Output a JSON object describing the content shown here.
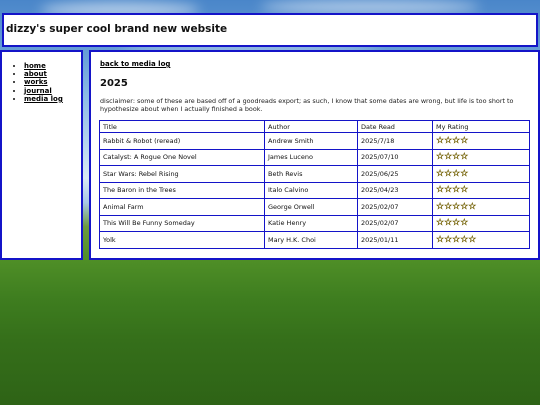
{
  "header": {
    "site_title": "dizzy's super cool brand new website"
  },
  "nav": {
    "items": [
      {
        "label": "home"
      },
      {
        "label": "about"
      },
      {
        "label": "works"
      },
      {
        "label": "journal"
      },
      {
        "label": "media log"
      }
    ]
  },
  "main": {
    "back_link": "back to media log",
    "year": "2025",
    "disclaimer": "disclaimer: some of these are based off of a goodreads export; as such, I know that some dates are wrong, but life is too short to hypothesize about when I actually finished a book.",
    "table": {
      "columns": [
        "Title",
        "Author",
        "Date Read",
        "My Rating"
      ],
      "rows": [
        {
          "title": "Rabbit & Robot (reread)",
          "author": "Andrew Smith",
          "date": "2025/7/18",
          "rating": 4,
          "stars": "☆☆☆☆"
        },
        {
          "title": "Catalyst: A Rogue One Novel",
          "author": "James Luceno",
          "date": "2025/07/10",
          "rating": 4,
          "stars": "☆☆☆☆"
        },
        {
          "title": "Star Wars: Rebel Rising",
          "author": "Beth Revis",
          "date": "2025/06/25",
          "rating": 4,
          "stars": "☆☆☆☆"
        },
        {
          "title": "The Baron in the Trees",
          "author": "Italo Calvino",
          "date": "2025/04/23",
          "rating": 4,
          "stars": "☆☆☆☆"
        },
        {
          "title": "Animal Farm",
          "author": "George Orwell",
          "date": "2025/02/07",
          "rating": 5,
          "stars": "☆☆☆☆☆"
        },
        {
          "title": "This Will Be Funny Someday",
          "author": "Katie Henry",
          "date": "2025/02/07",
          "rating": 4,
          "stars": "☆☆☆☆"
        },
        {
          "title": "Yolk",
          "author": "Mary H.K. Choi",
          "date": "2025/01/11",
          "rating": 5,
          "stars": "☆☆☆☆☆"
        }
      ]
    }
  },
  "colors": {
    "border": "#1414c8",
    "star": "#f1c40f"
  }
}
